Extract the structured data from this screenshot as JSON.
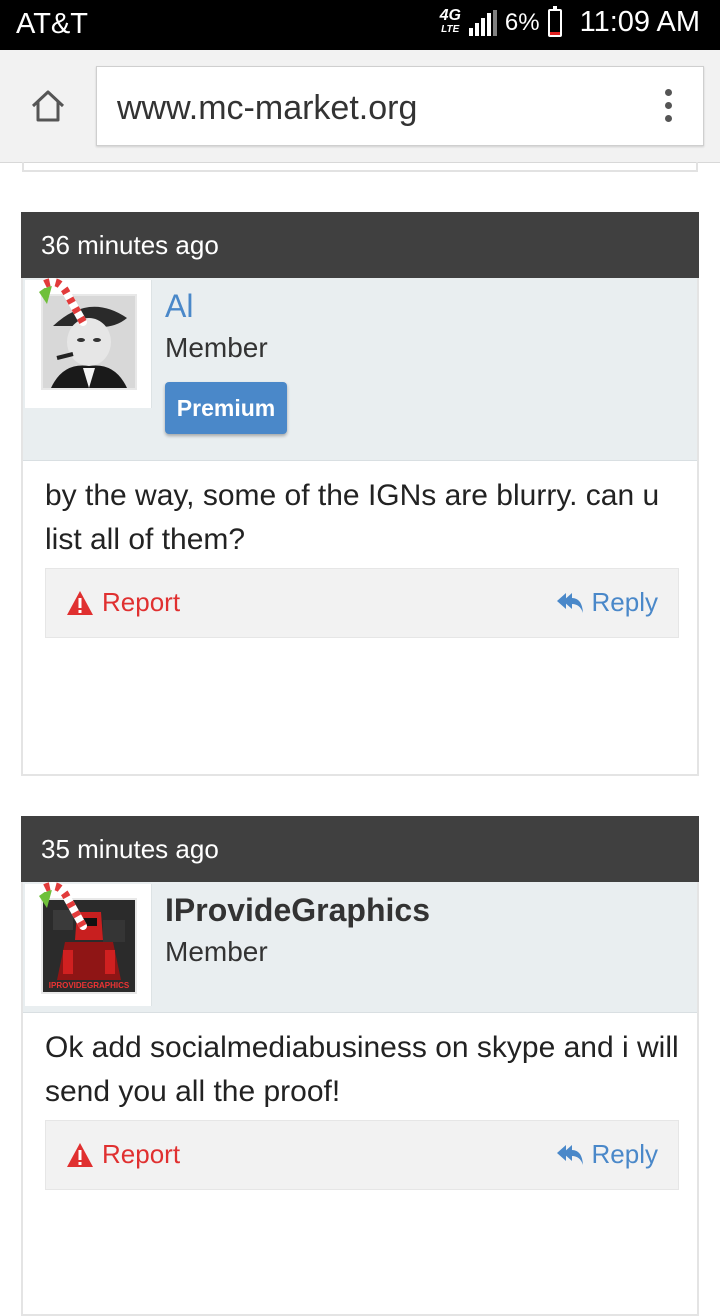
{
  "statusbar": {
    "carrier": "AT&T",
    "network": "4G",
    "network_sub": "LTE",
    "battery_pct": "6%",
    "time": "11:09 AM",
    "battery_level": 0.06
  },
  "browser": {
    "url": "www.mc-market.org",
    "home_icon": "home-icon",
    "menu_icon": "overflow-menu-icon"
  },
  "posts": [
    {
      "time": "36 minutes ago",
      "username": "Al",
      "role": "Member",
      "badge": "Premium",
      "message": "by the way, some of the IGNs are blurry. can u list all of them?",
      "report": "Report",
      "reply": "Reply"
    },
    {
      "time": "35 minutes ago",
      "username": "IProvideGraphics",
      "role": "Member",
      "message": "Ok add socialmediabusiness on skype and i will send you all the proof!",
      "report": "Report",
      "reply": "Reply",
      "avatar_text": "IPROVIDEGRAPHICS"
    }
  ],
  "colors": {
    "accent": "#4a88c9",
    "report": "#e03030",
    "header": "#404040",
    "userbar": "#e9eef0"
  }
}
